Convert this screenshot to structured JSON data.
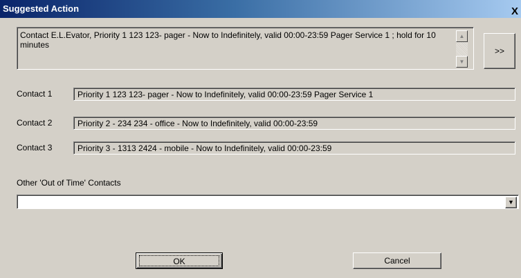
{
  "window": {
    "title": "Suggested Action",
    "close_label": "X"
  },
  "summary": {
    "text": "Contact E.L.Evator, Priority 1 123 123- pager - Now to Indefinitely, valid 00:00-23:59 Pager Service 1 ; hold for 10 minutes",
    "scroll_up": "▲",
    "scroll_down": "▼"
  },
  "more_button": ">>",
  "contacts": [
    {
      "label": "Contact 1",
      "value": "Priority 1 123 123- pager - Now to Indefinitely, valid 00:00-23:59 Pager Service 1"
    },
    {
      "label": "Contact 2",
      "value": "Priority  2 - 234 234 - office - Now to Indefinitely, valid 00:00-23:59"
    },
    {
      "label": "Contact 3",
      "value": "Priority  3 - 1313 2424 - mobile - Now to Indefinitely, valid 00:00-23:59"
    }
  ],
  "other_contacts": {
    "label": "Other 'Out of Time' Contacts",
    "value": "",
    "arrow": "▼"
  },
  "buttons": {
    "ok": "OK",
    "cancel": "Cancel"
  }
}
